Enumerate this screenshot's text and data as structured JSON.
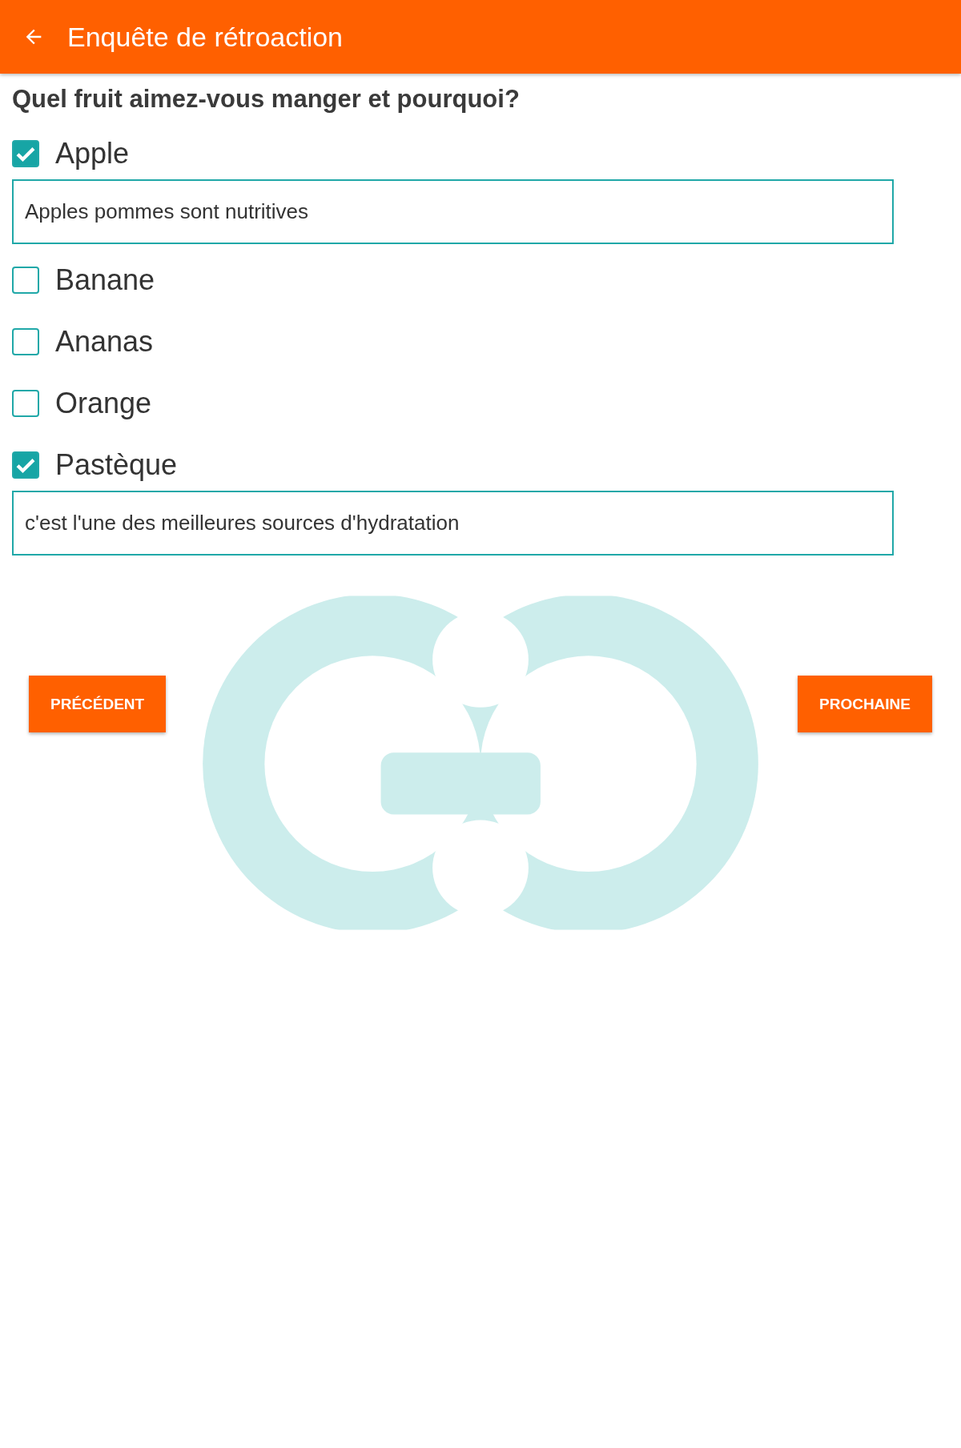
{
  "app_bar": {
    "title": "Enquête de rétroaction"
  },
  "question": "Quel fruit aimez-vous manger et pourquoi?",
  "options": [
    {
      "label": "Apple",
      "checked": true,
      "answer": "Apples pommes sont nutritives"
    },
    {
      "label": "Banane",
      "checked": false
    },
    {
      "label": "Ananas",
      "checked": false
    },
    {
      "label": "Orange",
      "checked": false
    },
    {
      "label": "Pastèque",
      "checked": true,
      "answer": "c'est l'une des meilleures sources d'hydratation"
    }
  ],
  "buttons": {
    "previous": "PRÉCÉDENT",
    "next": "PROCHAINE"
  }
}
